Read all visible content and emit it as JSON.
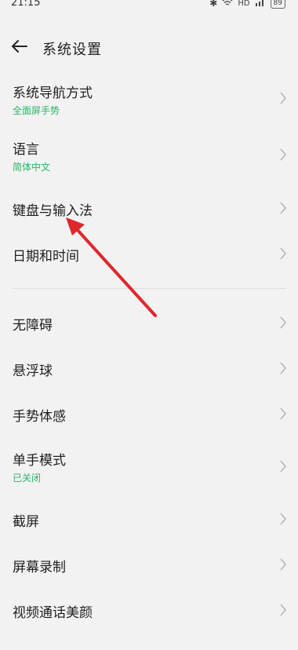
{
  "status": {
    "time": "21:15",
    "battery": "89",
    "hd": "HD"
  },
  "header": {
    "title": "系统设置"
  },
  "items": [
    {
      "label": "系统导航方式",
      "sub": "全面屏手势"
    },
    {
      "label": "语言",
      "sub": "简体中文"
    },
    {
      "label": "键盘与输入法",
      "sub": ""
    },
    {
      "label": "日期和时间",
      "sub": ""
    },
    {
      "label": "无障碍",
      "sub": ""
    },
    {
      "label": "悬浮球",
      "sub": ""
    },
    {
      "label": "手势体感",
      "sub": ""
    },
    {
      "label": "单手模式",
      "sub": "已关闭"
    },
    {
      "label": "截屏",
      "sub": ""
    },
    {
      "label": "屏幕录制",
      "sub": ""
    },
    {
      "label": "视频通话美颜",
      "sub": ""
    }
  ],
  "colors": {
    "accent_green": "#2fb267",
    "arrow_red": "#e0262b"
  },
  "icons": {
    "back": "arrow-left-icon",
    "chevron": "chevron-right-icon"
  }
}
